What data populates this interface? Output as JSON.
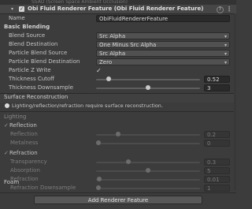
{
  "top_strip": "SSAO (Screen Space Ambient Occlusion)",
  "feature": {
    "title": "Obi Fluid Renderer Feature (Obi Fluid Renderer Feature)",
    "enabled": true,
    "name_label": "Name",
    "name_value": "ObiFluidRendererFeature"
  },
  "basic_blending": {
    "header": "Basic Blending",
    "fields": [
      {
        "label": "Blend Source",
        "value": "Src Alpha"
      },
      {
        "label": "Blend Destination",
        "value": "One Minus Src Alpha"
      },
      {
        "label": "Particle Blend Source",
        "value": "Src Alpha"
      },
      {
        "label": "Particle Blend Destination",
        "value": "Zero"
      }
    ],
    "particle_z_write": {
      "label": "Particle Z Write",
      "checked": true,
      "glyph": "✓"
    },
    "thickness_cutoff": {
      "label": "Thickness Cutoff",
      "value": "0.52",
      "fraction": 0.1
    },
    "thickness_downsample": {
      "label": "Thickness Downsample",
      "value": "3",
      "fraction": 0.5
    }
  },
  "surface": {
    "header": "Surface Reconstruction",
    "info": "Lighting/reflection/refraction require surface reconstruction."
  },
  "lighting": {
    "header": "Lighting",
    "reflection": {
      "label": "Reflection",
      "sliders": [
        {
          "label": "Reflection",
          "value": "0.2",
          "fraction": 0.2
        },
        {
          "label": "Metalness",
          "value": "0",
          "fraction": 0.0
        }
      ]
    },
    "refraction": {
      "label": "Refraction",
      "sliders": [
        {
          "label": "Transparency",
          "value": "0.3",
          "fraction": 0.3
        },
        {
          "label": "Absorption",
          "value": "5",
          "fraction": 0.5
        },
        {
          "label": "Refraction",
          "value": "0.01",
          "fraction": 0.01
        },
        {
          "label": "Refraction Downsample",
          "value": "1",
          "fraction": 0.0
        }
      ]
    }
  },
  "foam": {
    "header": "Foam"
  },
  "add_button": "Add Renderer Feature",
  "icons": {
    "expand": "▾",
    "dropdown": "▾",
    "help": "?",
    "menu": "⋮",
    "check": "✓"
  }
}
